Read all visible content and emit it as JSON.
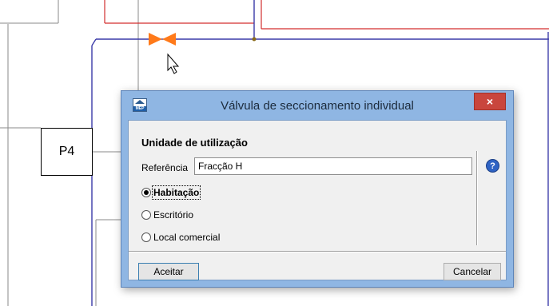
{
  "drawing": {
    "room_label": "P4",
    "colors": {
      "wall": "#8a8a8a",
      "pipe_blue": "#3a3aa8",
      "pipe_red": "#d32f2f",
      "valve": "#ff7a1a"
    },
    "icons": [
      "valve-icon",
      "mouse-pointer-icon"
    ]
  },
  "dialog": {
    "title": "Válvula de seccionamento individual",
    "close_label": "×",
    "app_icon_text": "MEP",
    "group_title": "Unidade de utilização",
    "reference_label": "Referência",
    "reference_value": "Fracção H",
    "help_label": "?",
    "options": [
      {
        "label": "Habitação",
        "selected": true
      },
      {
        "label": "Escritório",
        "selected": false
      },
      {
        "label": "Local comercial",
        "selected": false
      }
    ],
    "accept_label": "Aceitar",
    "cancel_label": "Cancelar",
    "colors": {
      "title_bar": "#8fb6e3",
      "close_button": "#c9463d",
      "client": "#f0f0f0"
    }
  }
}
